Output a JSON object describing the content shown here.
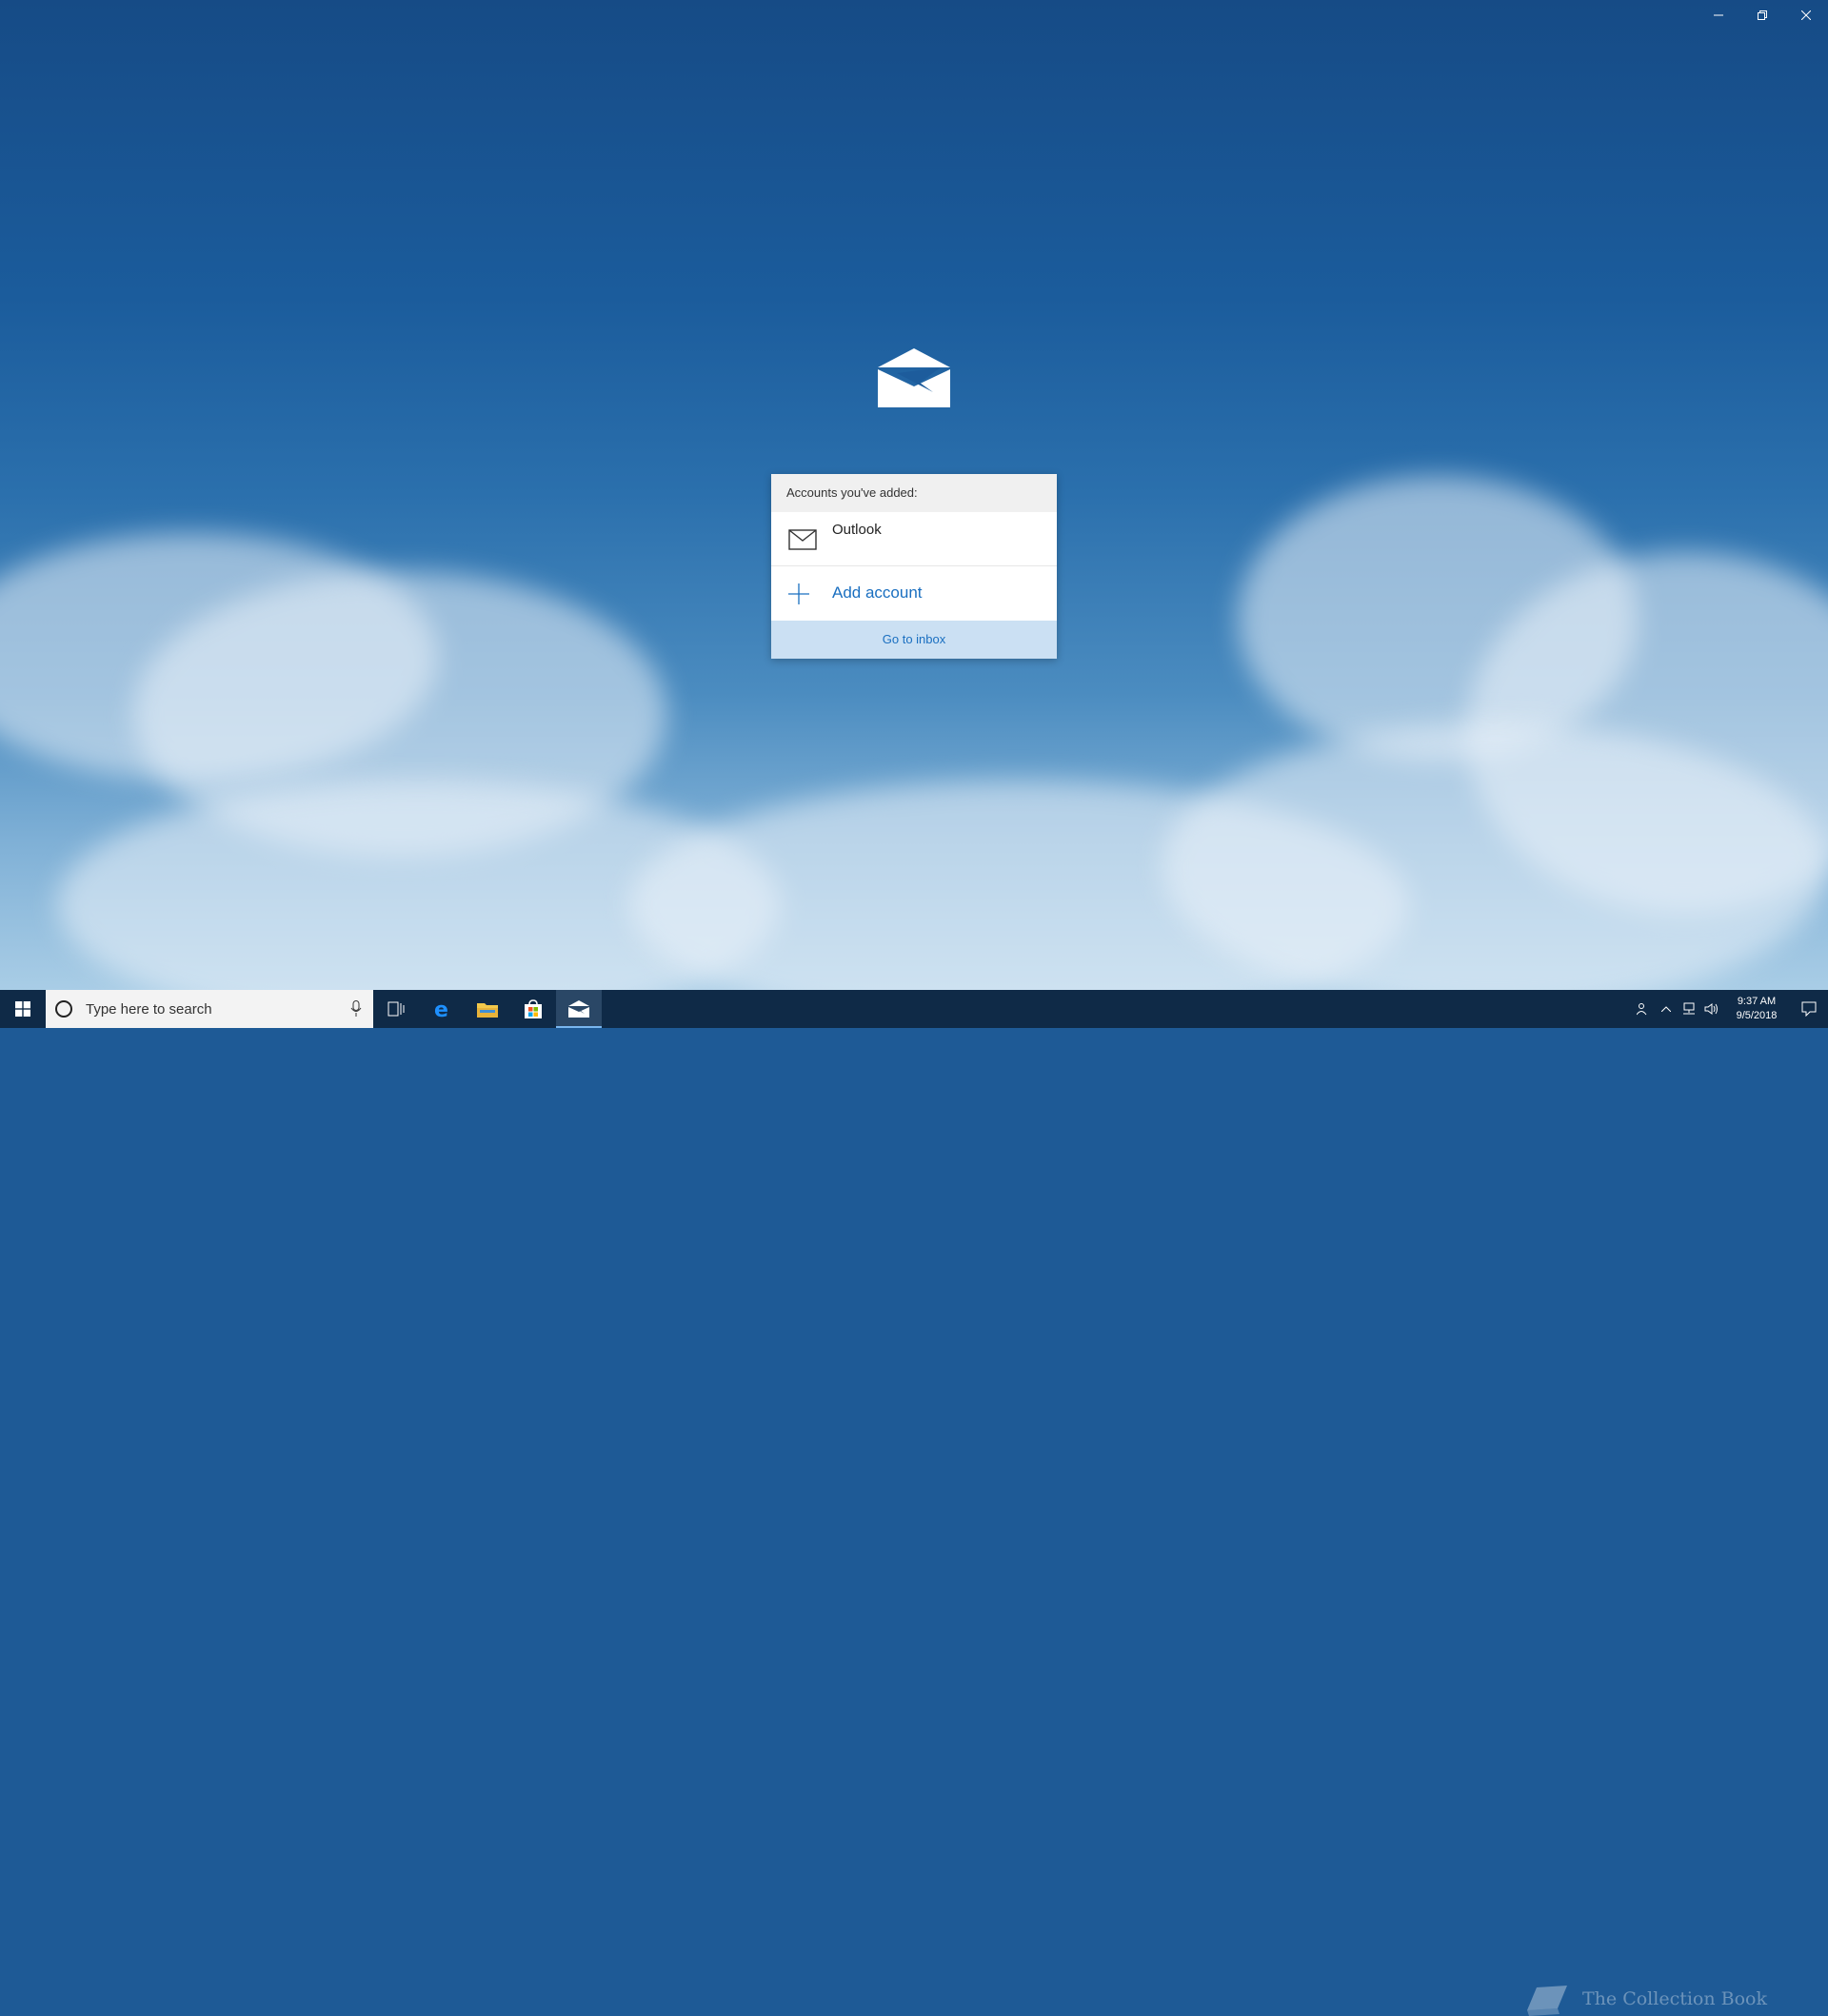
{
  "window": {
    "minimize_icon": "minimize-icon",
    "restore_icon": "restore-icon",
    "close_icon": "close-icon"
  },
  "dialog": {
    "header": "Accounts you've added:",
    "accounts": [
      {
        "name": "Outlook",
        "icon": "mail-icon"
      }
    ],
    "add_account_label": "Add account",
    "go_to_inbox_label": "Go to inbox"
  },
  "taskbar": {
    "search_placeholder": "Type here to search",
    "apps": [
      "task-view-icon",
      "edge-icon",
      "file-explorer-icon",
      "store-icon",
      "mail-app-icon"
    ],
    "active_app": "mail-app-icon",
    "clock_time": "9:37 AM",
    "clock_date": "9/5/2018",
    "watermark": "The Collection Book"
  },
  "colors": {
    "accent": "#1a6fc0",
    "inbox_button_bg": "#cbe0f3",
    "taskbar_bg": "#0f2a47"
  }
}
